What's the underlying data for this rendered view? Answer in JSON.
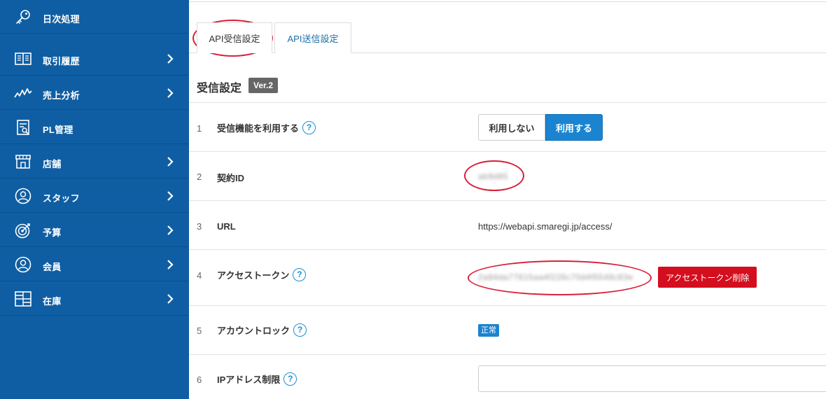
{
  "sidebar": {
    "items": [
      {
        "label": "日次処理",
        "icon": "key-icon",
        "has_chevron": false
      },
      {
        "label": "取引履歴",
        "icon": "book-icon",
        "has_chevron": true
      },
      {
        "label": "売上分析",
        "icon": "trend-icon",
        "has_chevron": true
      },
      {
        "label": "PL管理",
        "icon": "report-icon",
        "has_chevron": false
      },
      {
        "label": "店舗",
        "icon": "store-icon",
        "has_chevron": true
      },
      {
        "label": "スタッフ",
        "icon": "staff-icon",
        "has_chevron": true
      },
      {
        "label": "予算",
        "icon": "target-icon",
        "has_chevron": true
      },
      {
        "label": "会員",
        "icon": "member-icon",
        "has_chevron": true
      },
      {
        "label": "在庫",
        "icon": "grid-icon",
        "has_chevron": true
      }
    ]
  },
  "tabs": {
    "receive": "API受信設定",
    "send": "API送信設定"
  },
  "section": {
    "title": "受信設定",
    "version": "Ver.2"
  },
  "rows": [
    {
      "num": "1",
      "label": "受信機能を利用する",
      "off_label": "利用しない",
      "on_label": "利用する"
    },
    {
      "num": "2",
      "label": "契約ID",
      "value": "ab9d85"
    },
    {
      "num": "3",
      "label": "URL",
      "value": "https://webapi.smaregi.jp/access/"
    },
    {
      "num": "4",
      "label": "アクセストークン",
      "value": "2a84da77815aa4f226c70d4f5548c83e",
      "delete_label": "アクセストークン削除"
    },
    {
      "num": "5",
      "label": "アカウントロック",
      "status": "正常"
    },
    {
      "num": "6",
      "label": "IPアドレス制限",
      "input_value": ""
    }
  ],
  "help_glyph": "?",
  "colors": {
    "sidebar_bg": "#0f5ea3",
    "primary": "#1b84d0",
    "danger": "#d40e1f",
    "highlight_circle": "#d8203a"
  }
}
